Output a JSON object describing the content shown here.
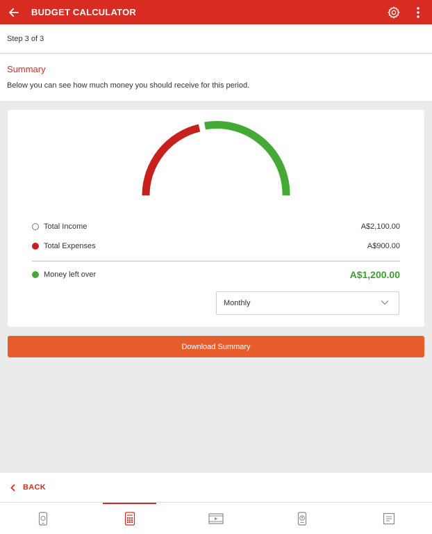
{
  "appbar": {
    "title": "BUDGET CALCULATOR"
  },
  "step": {
    "text": "Step 3 of 3"
  },
  "summary": {
    "heading": "Summary",
    "description": "Below you can see how much money you should receive for this period."
  },
  "breakdown": {
    "income_label": "Total Income",
    "income_value": "A$2,100.00",
    "expenses_label": "Total Expenses",
    "expenses_value": "A$900.00",
    "left_label": "Money left over",
    "left_value": "A$1,200.00"
  },
  "period_select": {
    "selected": "Monthly"
  },
  "download_label": "Download Summary",
  "back_label": "BACK",
  "colors": {
    "brand": "#d82b22",
    "expense": "#c6211c",
    "money_left": "#44a935",
    "download": "#e85d2c"
  },
  "tabs": [
    {
      "icon": "phone-money-icon",
      "active": false
    },
    {
      "icon": "calculator-icon",
      "active": true
    },
    {
      "icon": "video-icon",
      "active": false
    },
    {
      "icon": "mobile-dollar-icon",
      "active": false
    },
    {
      "icon": "list-icon",
      "active": false
    }
  ]
}
